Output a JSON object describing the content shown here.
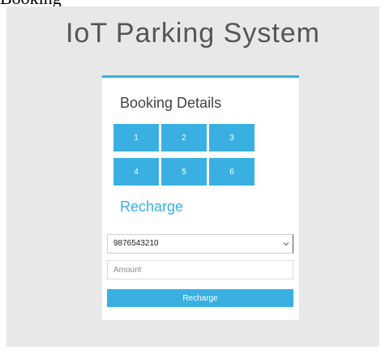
{
  "caption": "Booking",
  "header": {
    "title": "IoT Parking System"
  },
  "booking": {
    "title": "Booking Details",
    "slots": [
      "1",
      "2",
      "3",
      "4",
      "5",
      "6"
    ]
  },
  "recharge": {
    "title": "Recharge",
    "phone_selected": "9876543210",
    "amount_placeholder": "Amount",
    "button_label": "Recharge"
  },
  "colors": {
    "accent": "#3ab0e2",
    "page_background": "#e8e8e8",
    "card_background": "#ffffff",
    "title_text": "#555555"
  }
}
